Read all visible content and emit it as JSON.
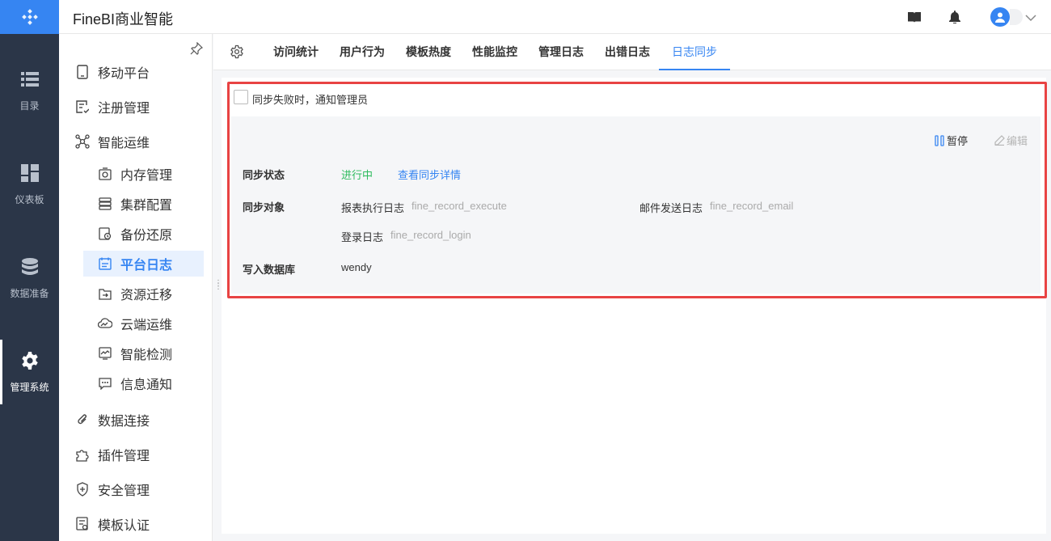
{
  "app": {
    "title": "FineBI商业智能"
  },
  "colors": {
    "accent": "#3685f2",
    "rail_bg": "#2b3648",
    "running": "#2dbb5d",
    "highlight_border": "#e84343"
  },
  "rail": {
    "items": [
      {
        "label": "目录",
        "icon": "list-icon"
      },
      {
        "label": "仪表板",
        "icon": "dashboard-icon"
      },
      {
        "label": "数据准备",
        "icon": "database-icon"
      },
      {
        "label": "管理系统",
        "icon": "gear-icon",
        "active": true
      }
    ]
  },
  "sidebar": {
    "items": [
      {
        "label": "移动平台",
        "icon": "mobile-icon"
      },
      {
        "label": "注册管理",
        "icon": "register-icon"
      },
      {
        "label": "智能运维",
        "icon": "ops-icon"
      },
      {
        "label": "内存管理",
        "icon": "memory-icon"
      },
      {
        "label": "集群配置",
        "icon": "cluster-icon"
      },
      {
        "label": "备份还原",
        "icon": "backup-icon"
      },
      {
        "label": "平台日志",
        "icon": "log-icon",
        "active": true
      },
      {
        "label": "资源迁移",
        "icon": "migrate-icon"
      },
      {
        "label": "云端运维",
        "icon": "cloud-icon"
      },
      {
        "label": "智能检测",
        "icon": "detect-icon"
      },
      {
        "label": "信息通知",
        "icon": "message-icon"
      },
      {
        "label": "数据连接",
        "icon": "link-icon"
      },
      {
        "label": "插件管理",
        "icon": "plugin-icon"
      },
      {
        "label": "安全管理",
        "icon": "shield-icon"
      },
      {
        "label": "模板认证",
        "icon": "certificate-icon"
      }
    ]
  },
  "tabs": [
    {
      "label": "访问统计"
    },
    {
      "label": "用户行为"
    },
    {
      "label": "模板热度"
    },
    {
      "label": "性能监控"
    },
    {
      "label": "管理日志"
    },
    {
      "label": "出错日志"
    },
    {
      "label": "日志同步",
      "active": true
    }
  ],
  "sync": {
    "notify_label": "同步失败时，通知管理员",
    "notify_checked": false,
    "pause_label": "暂停",
    "edit_label": "编辑",
    "status_label": "同步状态",
    "status_value": "进行中",
    "detail_link": "查看同步详情",
    "objects_label": "同步对象",
    "objects": [
      {
        "name": "报表执行日志",
        "table": "fine_record_execute"
      },
      {
        "name": "邮件发送日志",
        "table": "fine_record_email"
      },
      {
        "name": "登录日志",
        "table": "fine_record_login"
      }
    ],
    "db_label": "写入数据库",
    "db_value": "wendy"
  }
}
